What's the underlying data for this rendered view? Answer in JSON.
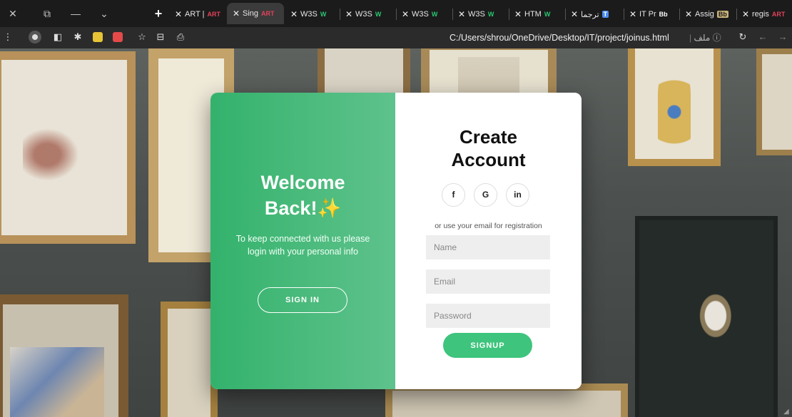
{
  "browser": {
    "tabs": [
      {
        "label": "ART |",
        "favicon": "ART",
        "favicon_color": "#e0425a",
        "active": false
      },
      {
        "label": "Sing",
        "favicon": "ART",
        "favicon_color": "#e0425a",
        "active": true
      },
      {
        "label": "W3S",
        "favicon": "W",
        "favicon_color": "#28c76f",
        "active": false
      },
      {
        "label": "W3S",
        "favicon": "W",
        "favicon_color": "#28c76f",
        "active": false
      },
      {
        "label": "W3S",
        "favicon": "W",
        "favicon_color": "#28c76f",
        "active": false
      },
      {
        "label": "W3S",
        "favicon": "W",
        "favicon_color": "#28c76f",
        "active": false
      },
      {
        "label": "HTM",
        "favicon": "W",
        "favicon_color": "#28c76f",
        "active": false
      },
      {
        "label": "ترجما",
        "favicon": "T",
        "favicon_color": "#4a8cf0",
        "active": false
      },
      {
        "label": "IT Pr",
        "favicon": "Bb",
        "favicon_color": "#ffffff",
        "active": false
      },
      {
        "label": "Assig",
        "favicon": "Bb",
        "favicon_color": "#c9b27a",
        "active": false
      },
      {
        "label": "regis",
        "favicon": "ART",
        "favicon_color": "#e0425a",
        "active": false
      }
    ],
    "address": "C:/Users/shrou/OneDrive/Desktop/IT/project/joinus.html",
    "address_prefix": "ملف",
    "icons": {
      "menu": "⋮",
      "reload": "↻",
      "back": "←",
      "forward": "→",
      "star": "☆",
      "info": "ⓘ"
    }
  },
  "welcome": {
    "title_line1": "Welcome",
    "title_line2": "Back!",
    "sparkle": "✨",
    "text": "To keep connected with us please login with your personal info",
    "signin_label": "SIGN IN"
  },
  "signup": {
    "title_line1": "Create",
    "title_line2": "Account",
    "social": {
      "facebook": "f",
      "google": "G",
      "linkedin": "in"
    },
    "hint": "or use your email for registration",
    "name_placeholder": "Name",
    "email_placeholder": "Email",
    "password_placeholder": "Password",
    "submit_label": "SIGNUP"
  },
  "colors": {
    "accent_green": "#3ec47c",
    "panel_green": "#33b26c",
    "card_bg": "#ffffff",
    "chrome_dark": "#1b1b1b"
  }
}
